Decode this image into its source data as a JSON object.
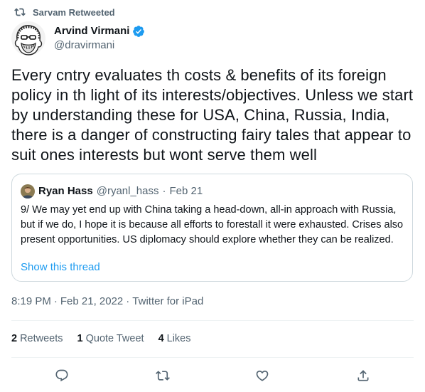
{
  "retweet_context": {
    "label": "Sarvam Retweeted",
    "icon": "retweet-icon"
  },
  "author": {
    "display_name": "Arvind Virmani",
    "handle": "@dravirmani",
    "verified_icon": "verified-badge-icon",
    "verified_color": "#1d9bf0"
  },
  "tweet": {
    "text": "Every cntry evaluates th costs & benefits of its foreign policy in th light of its interests/objectives. Unless we start by understanding these for USA, China, Russia, India, there is a danger of constructing fairy tales that appear to suit ones interests but wont serve them well"
  },
  "quote": {
    "name": "Ryan Hass",
    "handle": "@ryanl_hass",
    "separator": "·",
    "date": "Feb 21",
    "text": "9/ We may yet end up with China taking a head-down, all-in approach with Russia, but if we do, I hope it is because all efforts to forestall it were exhausted. Crises also present opportunities. US diplomacy should explore whether they can be realized.",
    "show_thread": "Show this thread"
  },
  "meta": {
    "time": "8:19 PM",
    "separator": "·",
    "date": "Feb 21, 2022",
    "separator2": "·",
    "source": "Twitter for iPad"
  },
  "stats": {
    "retweets_count": "2",
    "retweets_label": "Retweets",
    "quotes_count": "1",
    "quotes_label": "Quote Tweet",
    "likes_count": "4",
    "likes_label": "Likes"
  },
  "actions": {
    "reply_icon": "reply-icon",
    "retweet_icon": "retweet-icon",
    "like_icon": "heart-icon",
    "share_icon": "share-icon"
  },
  "colors": {
    "accent": "#1d9bf0",
    "text_primary": "#0f1419",
    "text_secondary": "#536471",
    "border": "#cfd9de"
  }
}
